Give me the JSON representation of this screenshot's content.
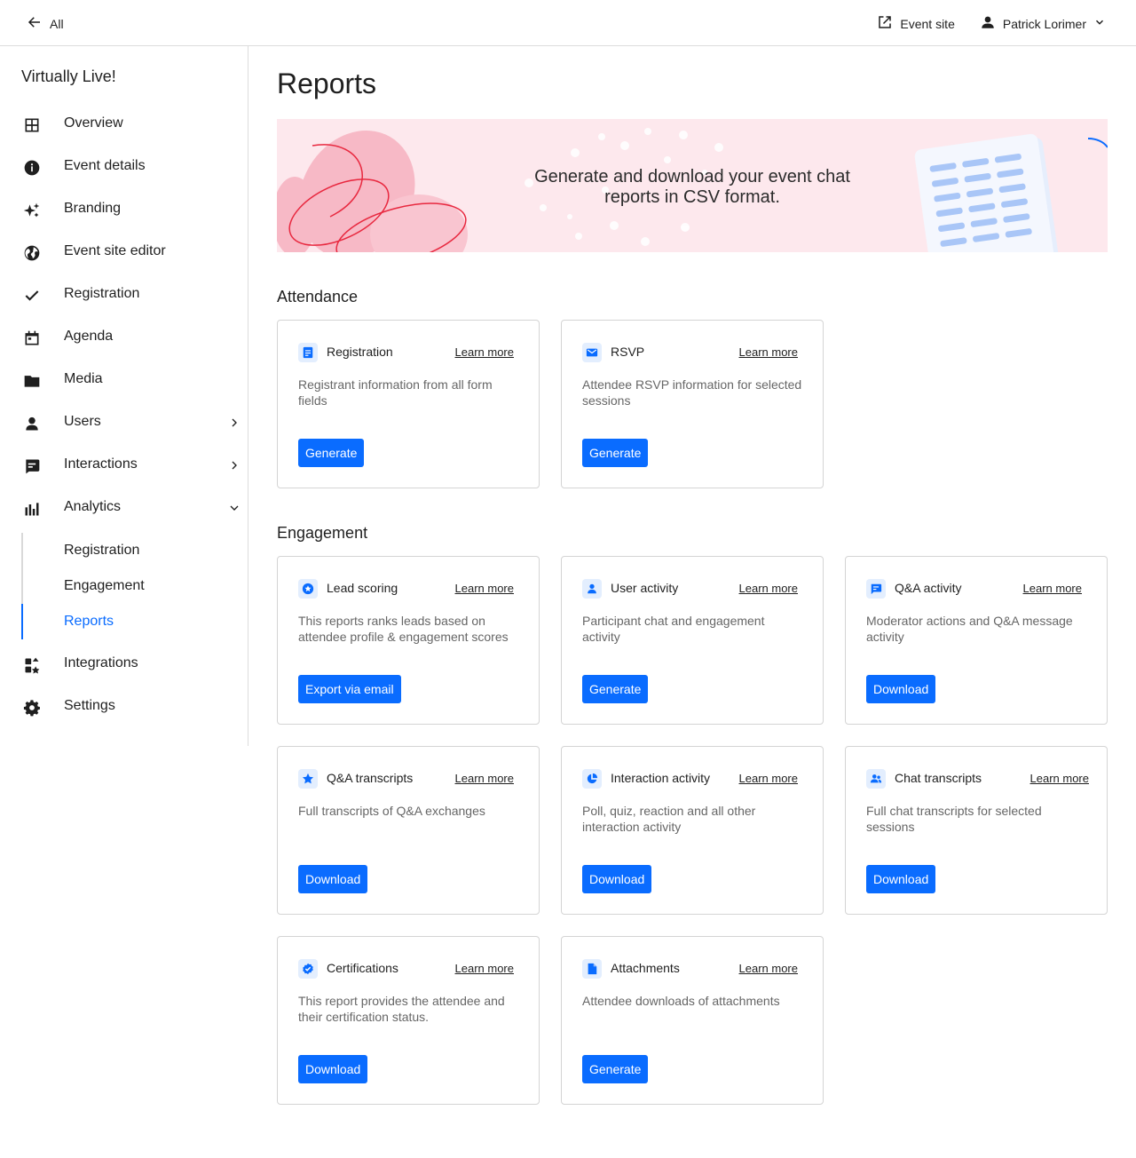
{
  "topbar": {
    "back_label": "All",
    "event_site_label": "Event site",
    "user_name": "Patrick Lorimer"
  },
  "sidebar": {
    "event_name": "Virtually Live!",
    "items": [
      {
        "label": "Overview",
        "icon": "grid-icon"
      },
      {
        "label": "Event details",
        "icon": "info-icon"
      },
      {
        "label": "Branding",
        "icon": "sparkle-icon"
      },
      {
        "label": "Event site editor",
        "icon": "globe-icon"
      },
      {
        "label": "Registration",
        "icon": "check-icon"
      },
      {
        "label": "Agenda",
        "icon": "calendar-icon"
      },
      {
        "label": "Media",
        "icon": "folder-icon"
      },
      {
        "label": "Users",
        "icon": "person-icon"
      },
      {
        "label": "Interactions",
        "icon": "chat-icon"
      },
      {
        "label": "Analytics",
        "icon": "bar-chart-icon"
      },
      {
        "label": "Integrations",
        "icon": "apps-icon"
      },
      {
        "label": "Settings",
        "icon": "gear-icon"
      }
    ],
    "analytics_sub": [
      {
        "label": "Registration"
      },
      {
        "label": "Engagement"
      },
      {
        "label": "Reports"
      }
    ]
  },
  "main": {
    "title": "Reports",
    "banner_text": "Generate and download your event chat reports in CSV format.",
    "sections": [
      {
        "title": "Attendance",
        "cards": [
          {
            "title": "Registration",
            "learn": "Learn more",
            "desc": "Registrant information from all form fields",
            "button": "Generate",
            "icon": "form-icon"
          },
          {
            "title": "RSVP",
            "learn": "Learn more",
            "desc": "Attendee RSVP information for selected sessions",
            "button": "Generate",
            "icon": "mail-icon"
          }
        ]
      },
      {
        "title": "Engagement",
        "cards": [
          {
            "title": "Lead scoring",
            "learn": "Learn more",
            "desc": "This reports ranks leads based on attendee profile & engagement scores",
            "button": "Export via email",
            "icon": "star-circle-icon"
          },
          {
            "title": "User activity",
            "learn": "Learn more",
            "desc": "Participant chat and engagement activity",
            "button": "Generate",
            "icon": "person-icon"
          },
          {
            "title": "Q&A activity",
            "learn": "Learn more",
            "desc": "Moderator actions and Q&A message activity",
            "button": "Download",
            "icon": "chat-icon"
          },
          {
            "title": "Q&A transcripts",
            "learn": "Learn more",
            "desc": "Full transcripts of Q&A exchanges",
            "button": "Download",
            "icon": "star-icon"
          },
          {
            "title": "Interaction activity",
            "learn": "Learn more",
            "desc": "Poll, quiz, reaction and all other interaction activity",
            "button": "Download",
            "icon": "pie-icon"
          },
          {
            "title": "Chat transcripts",
            "learn": "Learn more",
            "desc": "Full chat transcripts for selected sessions",
            "button": "Download",
            "icon": "people-icon"
          },
          {
            "title": "Certifications",
            "learn": "Learn more",
            "desc": "This report provides the attendee and their certification status.",
            "button": "Download",
            "icon": "badge-check-icon"
          },
          {
            "title": "Attachments",
            "learn": "Learn more",
            "desc": "Attendee downloads of attachments",
            "button": "Generate",
            "icon": "file-icon"
          }
        ]
      }
    ]
  },
  "colors": {
    "accent": "#0a6cff",
    "banner_bg": "#fde8ed",
    "icon_bg": "#e3eefe"
  }
}
